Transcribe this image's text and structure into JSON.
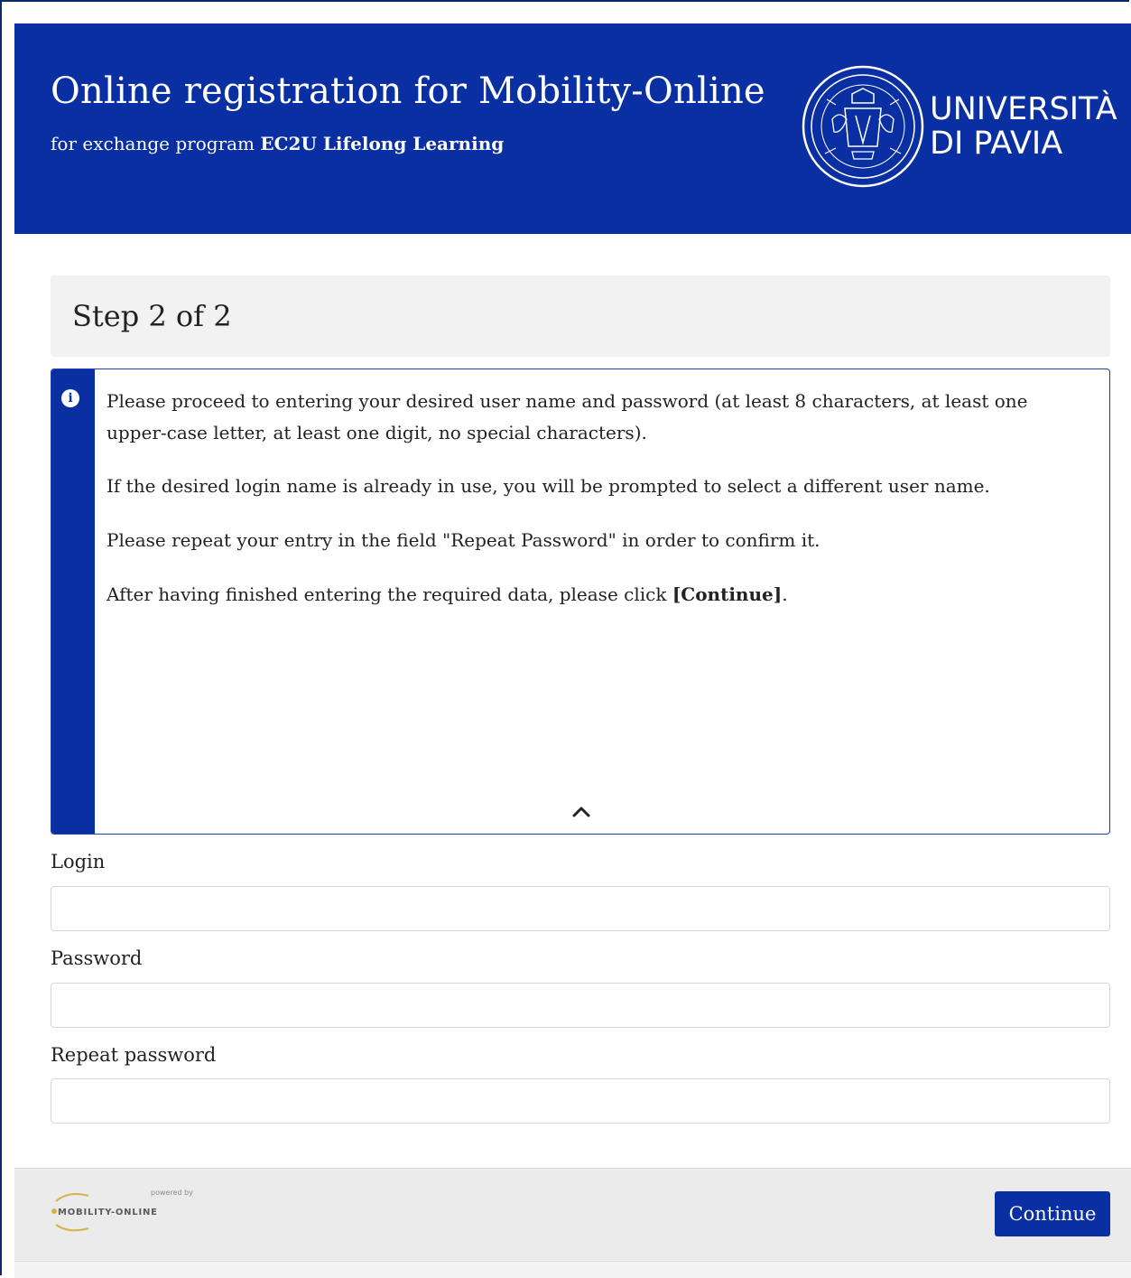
{
  "header": {
    "title": "Online registration for Mobility-Online",
    "subtitle_prefix": "for exchange program ",
    "program_name": "EC2U Lifelong Learning",
    "university_line1": "UNIVERSITÀ",
    "university_line2": "DI PAVIA"
  },
  "step": {
    "title": "Step 2 of 2"
  },
  "info": {
    "paragraph1": "Please proceed to entering your desired user name and password (at least 8 characters, at least one upper-case letter, at least one digit, no special characters).",
    "paragraph2": "If the desired login name is already in use, you will be prompted to select a different user name.",
    "paragraph3": "Please repeat your entry in the field \"Repeat Password\" in order to confirm it.",
    "paragraph4_prefix": "After having finished entering the required data, please click ",
    "paragraph4_bold": "[Continue]",
    "paragraph4_suffix": "."
  },
  "form": {
    "login_label": "Login",
    "login_value": "",
    "password_label": "Password",
    "password_value": "",
    "repeat_label": "Repeat password",
    "repeat_value": ""
  },
  "footer": {
    "powered_by": "powered by",
    "brand": "MOBILITY-ONLINE",
    "continue_label": "Continue"
  },
  "colors": {
    "primary": "#0a2fa3",
    "footer_bg": "#ebebeb",
    "step_bg": "#f2f2f2"
  }
}
